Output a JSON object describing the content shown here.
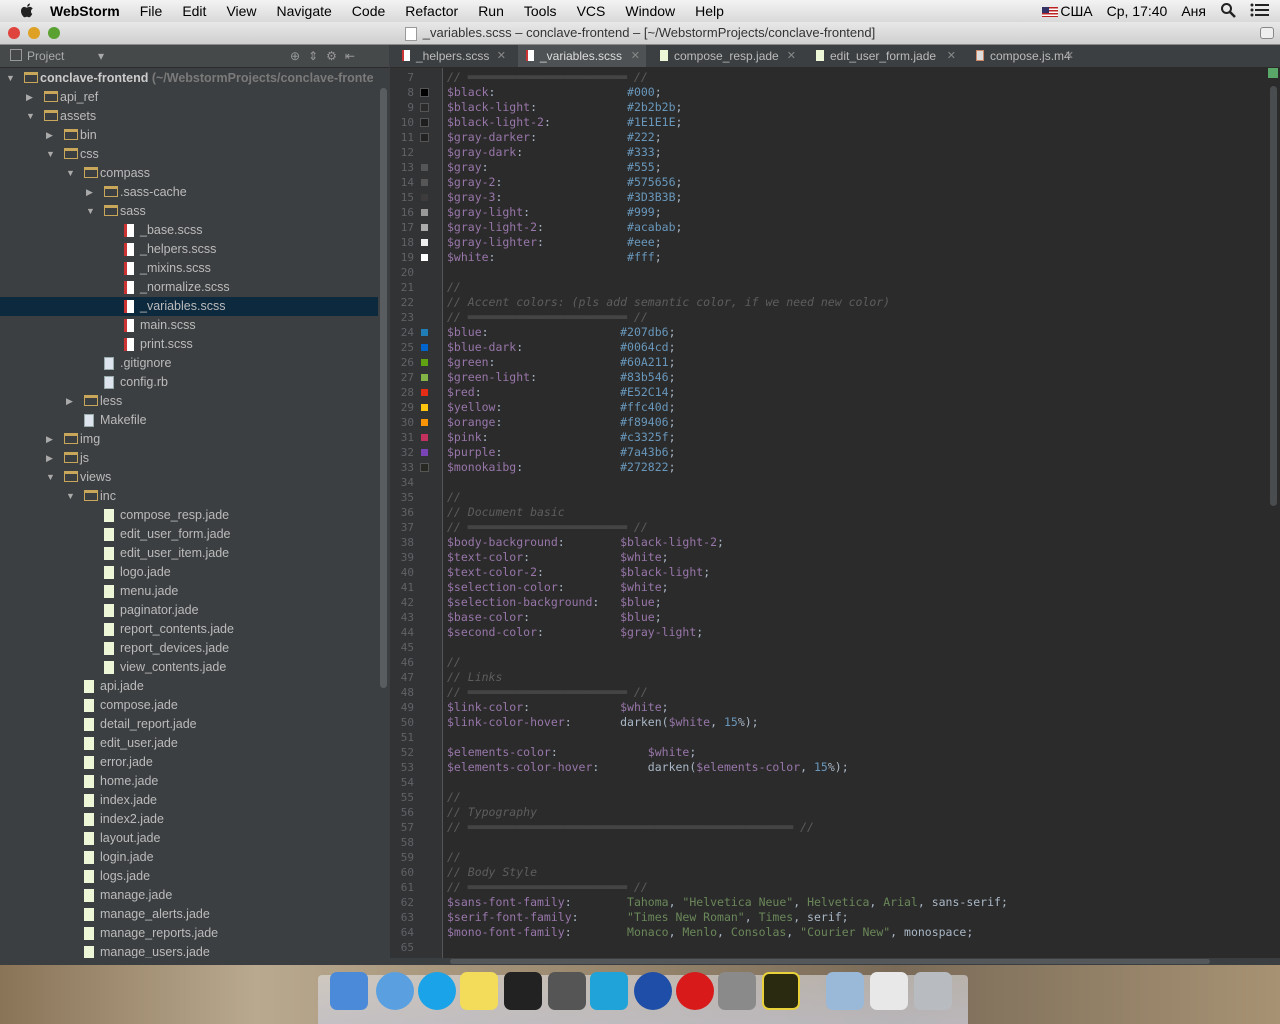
{
  "menubar": {
    "app_name": "WebStorm",
    "items": [
      "File",
      "Edit",
      "View",
      "Navigate",
      "Code",
      "Refactor",
      "Run",
      "Tools",
      "VCS",
      "Window",
      "Help"
    ],
    "locale": "США",
    "clock": "Ср, 17:40",
    "user": "Аня"
  },
  "window": {
    "title": "_variables.scss – conclave-frontend – [~/WebstormProjects/conclave-frontend]"
  },
  "project_panel": {
    "title": "Project",
    "tree": [
      {
        "label": "conclave-frontend",
        "suffix": " (~/WebstormProjects/conclave-fronte",
        "depth": 0,
        "type": "folder",
        "open": true,
        "bold": true
      },
      {
        "label": "api_ref",
        "depth": 1,
        "type": "folder",
        "open": false
      },
      {
        "label": "assets",
        "depth": 1,
        "type": "folder",
        "open": true
      },
      {
        "label": "bin",
        "depth": 2,
        "type": "folder",
        "open": false
      },
      {
        "label": "css",
        "depth": 2,
        "type": "folder",
        "open": true
      },
      {
        "label": "compass",
        "depth": 3,
        "type": "folder",
        "open": true
      },
      {
        "label": ".sass-cache",
        "depth": 4,
        "type": "folder",
        "open": false
      },
      {
        "label": "sass",
        "depth": 4,
        "type": "folder",
        "open": true
      },
      {
        "label": "_base.scss",
        "depth": 5,
        "type": "scss"
      },
      {
        "label": "_helpers.scss",
        "depth": 5,
        "type": "scss"
      },
      {
        "label": "_mixins.scss",
        "depth": 5,
        "type": "scss"
      },
      {
        "label": "_normalize.scss",
        "depth": 5,
        "type": "scss"
      },
      {
        "label": "_variables.scss",
        "depth": 5,
        "type": "scss",
        "selected": true
      },
      {
        "label": "main.scss",
        "depth": 5,
        "type": "scss"
      },
      {
        "label": "print.scss",
        "depth": 5,
        "type": "scss"
      },
      {
        "label": ".gitignore",
        "depth": 4,
        "type": "cfg"
      },
      {
        "label": "config.rb",
        "depth": 4,
        "type": "cfg"
      },
      {
        "label": "less",
        "depth": 3,
        "type": "folder",
        "open": false
      },
      {
        "label": "Makefile",
        "depth": 3,
        "type": "cfg"
      },
      {
        "label": "img",
        "depth": 2,
        "type": "folder",
        "open": false
      },
      {
        "label": "js",
        "depth": 2,
        "type": "folder",
        "open": false
      },
      {
        "label": "views",
        "depth": 2,
        "type": "folder",
        "open": true
      },
      {
        "label": "inc",
        "depth": 3,
        "type": "folder",
        "open": true
      },
      {
        "label": "compose_resp.jade",
        "depth": 4,
        "type": "jade"
      },
      {
        "label": "edit_user_form.jade",
        "depth": 4,
        "type": "jade"
      },
      {
        "label": "edit_user_item.jade",
        "depth": 4,
        "type": "jade"
      },
      {
        "label": "logo.jade",
        "depth": 4,
        "type": "jade"
      },
      {
        "label": "menu.jade",
        "depth": 4,
        "type": "jade"
      },
      {
        "label": "paginator.jade",
        "depth": 4,
        "type": "jade"
      },
      {
        "label": "report_contents.jade",
        "depth": 4,
        "type": "jade"
      },
      {
        "label": "report_devices.jade",
        "depth": 4,
        "type": "jade"
      },
      {
        "label": "view_contents.jade",
        "depth": 4,
        "type": "jade"
      },
      {
        "label": "api.jade",
        "depth": 3,
        "type": "jade"
      },
      {
        "label": "compose.jade",
        "depth": 3,
        "type": "jade"
      },
      {
        "label": "detail_report.jade",
        "depth": 3,
        "type": "jade"
      },
      {
        "label": "edit_user.jade",
        "depth": 3,
        "type": "jade"
      },
      {
        "label": "error.jade",
        "depth": 3,
        "type": "jade"
      },
      {
        "label": "home.jade",
        "depth": 3,
        "type": "jade"
      },
      {
        "label": "index.jade",
        "depth": 3,
        "type": "jade"
      },
      {
        "label": "index2.jade",
        "depth": 3,
        "type": "jade"
      },
      {
        "label": "layout.jade",
        "depth": 3,
        "type": "jade"
      },
      {
        "label": "login.jade",
        "depth": 3,
        "type": "jade"
      },
      {
        "label": "logs.jade",
        "depth": 3,
        "type": "jade"
      },
      {
        "label": "manage.jade",
        "depth": 3,
        "type": "jade"
      },
      {
        "label": "manage_alerts.jade",
        "depth": 3,
        "type": "jade"
      },
      {
        "label": "manage_reports.jade",
        "depth": 3,
        "type": "jade"
      },
      {
        "label": "manage_users.jade",
        "depth": 3,
        "type": "jade"
      }
    ]
  },
  "tabs": [
    {
      "label": "_helpers.scss",
      "type": "scss",
      "active": false
    },
    {
      "label": "_variables.scss",
      "type": "scss",
      "active": true
    },
    {
      "label": "compose_resp.jade",
      "type": "jade",
      "active": false
    },
    {
      "label": "edit_user_form.jade",
      "type": "jade",
      "active": false
    },
    {
      "label": "compose.js.m4",
      "type": "m4",
      "active": false
    }
  ],
  "editor": {
    "first_line": 7,
    "lines": [
      [
        [
          "c",
          "// ═══════════════════════ //"
        ]
      ],
      [
        [
          "v",
          "$black"
        ],
        [
          "h",
          ":                   "
        ],
        [
          "n",
          "#000"
        ],
        [
          "h",
          ";"
        ]
      ],
      [
        [
          "v",
          "$black-light"
        ],
        [
          "h",
          ":             "
        ],
        [
          "n",
          "#2b2b2b"
        ],
        [
          "h",
          ";"
        ]
      ],
      [
        [
          "v",
          "$black-light-2"
        ],
        [
          "h",
          ":           "
        ],
        [
          "n",
          "#1E1E1E"
        ],
        [
          "h",
          ";"
        ]
      ],
      [
        [
          "v",
          "$gray-darker"
        ],
        [
          "h",
          ":             "
        ],
        [
          "n",
          "#222"
        ],
        [
          "h",
          ";"
        ]
      ],
      [
        [
          "v",
          "$gray-dark"
        ],
        [
          "h",
          ":               "
        ],
        [
          "n",
          "#333"
        ],
        [
          "h",
          ";"
        ]
      ],
      [
        [
          "v",
          "$gray"
        ],
        [
          "h",
          ":                    "
        ],
        [
          "n",
          "#555"
        ],
        [
          "h",
          ";"
        ]
      ],
      [
        [
          "v",
          "$gray-2"
        ],
        [
          "h",
          ":                  "
        ],
        [
          "n",
          "#575656"
        ],
        [
          "h",
          ";"
        ]
      ],
      [
        [
          "v",
          "$gray-3"
        ],
        [
          "h",
          ":                  "
        ],
        [
          "n",
          "#3D3B3B"
        ],
        [
          "h",
          ";"
        ]
      ],
      [
        [
          "v",
          "$gray-light"
        ],
        [
          "h",
          ":              "
        ],
        [
          "n",
          "#999"
        ],
        [
          "h",
          ";"
        ]
      ],
      [
        [
          "v",
          "$gray-light-2"
        ],
        [
          "h",
          ":            "
        ],
        [
          "n",
          "#acabab"
        ],
        [
          "h",
          ";"
        ]
      ],
      [
        [
          "v",
          "$gray-lighter"
        ],
        [
          "h",
          ":            "
        ],
        [
          "n",
          "#eee"
        ],
        [
          "h",
          ";"
        ]
      ],
      [
        [
          "v",
          "$white"
        ],
        [
          "h",
          ":                   "
        ],
        [
          "n",
          "#fff"
        ],
        [
          "h",
          ";"
        ]
      ],
      [],
      [
        [
          "c",
          "//"
        ]
      ],
      [
        [
          "c",
          "// Accent colors: (pls add semantic color, if we need new color)"
        ]
      ],
      [
        [
          "c",
          "// ═══════════════════════ //"
        ]
      ],
      [
        [
          "v",
          "$blue"
        ],
        [
          "h",
          ":                   "
        ],
        [
          "n",
          "#207db6"
        ],
        [
          "h",
          ";"
        ]
      ],
      [
        [
          "v",
          "$blue-dark"
        ],
        [
          "h",
          ":              "
        ],
        [
          "n",
          "#0064cd"
        ],
        [
          "h",
          ";"
        ]
      ],
      [
        [
          "v",
          "$green"
        ],
        [
          "h",
          ":                  "
        ],
        [
          "n",
          "#60A211"
        ],
        [
          "h",
          ";"
        ]
      ],
      [
        [
          "v",
          "$green-light"
        ],
        [
          "h",
          ":            "
        ],
        [
          "n",
          "#83b546"
        ],
        [
          "h",
          ";"
        ]
      ],
      [
        [
          "v",
          "$red"
        ],
        [
          "h",
          ":                    "
        ],
        [
          "n",
          "#E52C14"
        ],
        [
          "h",
          ";"
        ]
      ],
      [
        [
          "v",
          "$yellow"
        ],
        [
          "h",
          ":                 "
        ],
        [
          "n",
          "#ffc40d"
        ],
        [
          "h",
          ";"
        ]
      ],
      [
        [
          "v",
          "$orange"
        ],
        [
          "h",
          ":                 "
        ],
        [
          "n",
          "#f89406"
        ],
        [
          "h",
          ";"
        ]
      ],
      [
        [
          "v",
          "$pink"
        ],
        [
          "h",
          ":                   "
        ],
        [
          "n",
          "#c3325f"
        ],
        [
          "h",
          ";"
        ]
      ],
      [
        [
          "v",
          "$purple"
        ],
        [
          "h",
          ":                 "
        ],
        [
          "n",
          "#7a43b6"
        ],
        [
          "h",
          ";"
        ]
      ],
      [
        [
          "v",
          "$monokaibg"
        ],
        [
          "h",
          ":              "
        ],
        [
          "n",
          "#272822"
        ],
        [
          "h",
          ";"
        ]
      ],
      [],
      [
        [
          "c",
          "//"
        ]
      ],
      [
        [
          "c",
          "// Document basic"
        ]
      ],
      [
        [
          "c",
          "// ═══════════════════════ //"
        ]
      ],
      [
        [
          "v",
          "$body-background"
        ],
        [
          "h",
          ":        "
        ],
        [
          "v",
          "$black-light-2"
        ],
        [
          "h",
          ";"
        ]
      ],
      [
        [
          "v",
          "$text-color"
        ],
        [
          "h",
          ":             "
        ],
        [
          "v",
          "$white"
        ],
        [
          "h",
          ";"
        ]
      ],
      [
        [
          "v",
          "$text-color-2"
        ],
        [
          "h",
          ":           "
        ],
        [
          "v",
          "$black-light"
        ],
        [
          "h",
          ";"
        ]
      ],
      [
        [
          "v",
          "$selection-color"
        ],
        [
          "h",
          ":        "
        ],
        [
          "v",
          "$white"
        ],
        [
          "h",
          ";"
        ]
      ],
      [
        [
          "v",
          "$selection-background"
        ],
        [
          "h",
          ":   "
        ],
        [
          "v",
          "$blue"
        ],
        [
          "h",
          ";"
        ]
      ],
      [
        [
          "v",
          "$base-color"
        ],
        [
          "h",
          ":             "
        ],
        [
          "v",
          "$blue"
        ],
        [
          "h",
          ";"
        ]
      ],
      [
        [
          "v",
          "$second-color"
        ],
        [
          "h",
          ":           "
        ],
        [
          "v",
          "$gray-light"
        ],
        [
          "h",
          ";"
        ]
      ],
      [],
      [
        [
          "c",
          "//"
        ]
      ],
      [
        [
          "c",
          "// Links"
        ]
      ],
      [
        [
          "c",
          "// ═══════════════════════ //"
        ]
      ],
      [
        [
          "v",
          "$link-color"
        ],
        [
          "h",
          ":             "
        ],
        [
          "v",
          "$white"
        ],
        [
          "h",
          ";"
        ]
      ],
      [
        [
          "v",
          "$link-color-hover"
        ],
        [
          "h",
          ":       "
        ],
        [
          "h",
          "darken("
        ],
        [
          "v",
          "$white"
        ],
        [
          "h",
          ", "
        ],
        [
          "n",
          "15"
        ],
        [
          "h",
          "%);"
        ]
      ],
      [],
      [
        [
          "v",
          "$elements-color"
        ],
        [
          "h",
          ":             "
        ],
        [
          "v",
          "$white"
        ],
        [
          "h",
          ";"
        ]
      ],
      [
        [
          "v",
          "$elements-color-hover"
        ],
        [
          "h",
          ":       "
        ],
        [
          "h",
          "darken("
        ],
        [
          "v",
          "$elements-color"
        ],
        [
          "h",
          ", "
        ],
        [
          "n",
          "15"
        ],
        [
          "h",
          "%);"
        ]
      ],
      [],
      [
        [
          "c",
          "//"
        ]
      ],
      [
        [
          "c",
          "// Typography"
        ]
      ],
      [
        [
          "c",
          "// ═══════════════════════════════════════════════ //"
        ]
      ],
      [],
      [
        [
          "c",
          "//"
        ]
      ],
      [
        [
          "c",
          "// Body Style"
        ]
      ],
      [
        [
          "c",
          "// ═══════════════════════ //"
        ]
      ],
      [
        [
          "v",
          "$sans-font-family"
        ],
        [
          "h",
          ":        "
        ],
        [
          "s",
          "Tahoma"
        ],
        [
          "h",
          ", "
        ],
        [
          "s",
          "\"Helvetica Neue\""
        ],
        [
          "h",
          ", "
        ],
        [
          "s",
          "Helvetica"
        ],
        [
          "h",
          ", "
        ],
        [
          "s",
          "Arial"
        ],
        [
          "h",
          ", sans-serif;"
        ]
      ],
      [
        [
          "v",
          "$serif-font-family"
        ],
        [
          "h",
          ":       "
        ],
        [
          "s",
          "\"Times New Roman\""
        ],
        [
          "h",
          ", "
        ],
        [
          "s",
          "Times"
        ],
        [
          "h",
          ", serif;"
        ]
      ],
      [
        [
          "v",
          "$mono-font-family"
        ],
        [
          "h",
          ":        "
        ],
        [
          "s",
          "Monaco"
        ],
        [
          "h",
          ", "
        ],
        [
          "s",
          "Menlo"
        ],
        [
          "h",
          ", "
        ],
        [
          "s",
          "Consolas"
        ],
        [
          "h",
          ", "
        ],
        [
          "s",
          "\"Courier New\""
        ],
        [
          "h",
          ", monospace;"
        ]
      ],
      []
    ],
    "swatches": {
      "8": "#000000",
      "9": "#2b2b2b",
      "10": "#1E1E1E",
      "11": "#222222",
      "12": "#333333",
      "13": "#555555",
      "14": "#575656",
      "15": "#3D3B3B",
      "16": "#999999",
      "17": "#acabab",
      "18": "#eeeeee",
      "19": "#ffffff",
      "24": "#207db6",
      "25": "#0064cd",
      "26": "#60A211",
      "27": "#83b546",
      "28": "#E52C14",
      "29": "#ffc40d",
      "30": "#f89406",
      "31": "#c3325f",
      "32": "#7a43b6",
      "33": "#272822"
    }
  },
  "dock": {
    "apps": [
      {
        "name": "finder-icon",
        "color": "#4a8ad8"
      },
      {
        "name": "safari-icon",
        "color": "#5aa0e0"
      },
      {
        "name": "skype-icon",
        "color": "#1aa3e8"
      },
      {
        "name": "stickies-icon",
        "color": "#f2dc5a"
      },
      {
        "name": "terminal-icon",
        "color": "#222222"
      },
      {
        "name": "sublime-text-icon",
        "color": "#555555"
      },
      {
        "name": "webstorm-icon",
        "color": "#1fa3d8"
      },
      {
        "name": "globe-browser-icon",
        "color": "#1e4ea8"
      },
      {
        "name": "opera-icon",
        "color": "#d81a1a"
      },
      {
        "name": "system-preferences-icon",
        "color": "#8a8a8a"
      },
      {
        "name": "fireworks-icon",
        "color": "#2a2a10"
      },
      {
        "name": "downloads-folder-icon",
        "color": "#9ab8d8"
      },
      {
        "name": "mail-icon",
        "color": "#e8e8e8"
      },
      {
        "name": "trash-icon",
        "color": "#b8bcc0"
      }
    ]
  }
}
